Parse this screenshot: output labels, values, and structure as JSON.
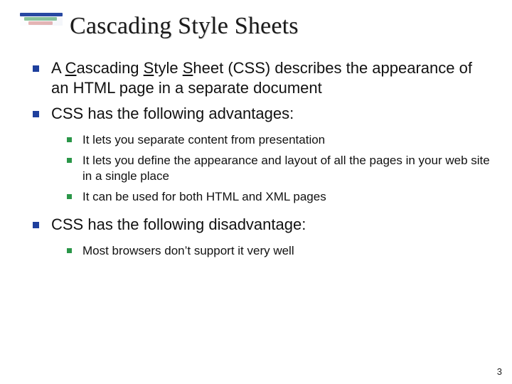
{
  "title": "Cascading Style Sheets",
  "bullets": {
    "b1_pre": "A ",
    "b1_css_C": "C",
    "b1_css_ascading": "ascading ",
    "b1_css_S1": "S",
    "b1_css_tyle": "tyle ",
    "b1_css_S2": "S",
    "b1_css_heet": "heet",
    "b1_mid": " (CSS) describes the appearance of an HTML page in a separate document",
    "b2": "CSS has the following advantages:",
    "b2_sub1": "It lets you separate content from presentation",
    "b2_sub2": "It lets you define the appearance and layout of all the pages in your web site in a single place",
    "b2_sub3": "It can be used for both HTML and XML pages",
    "b3": "CSS has the following disadvantage:",
    "b3_sub1": "Most browsers don’t support it very well"
  },
  "page_number": "3"
}
